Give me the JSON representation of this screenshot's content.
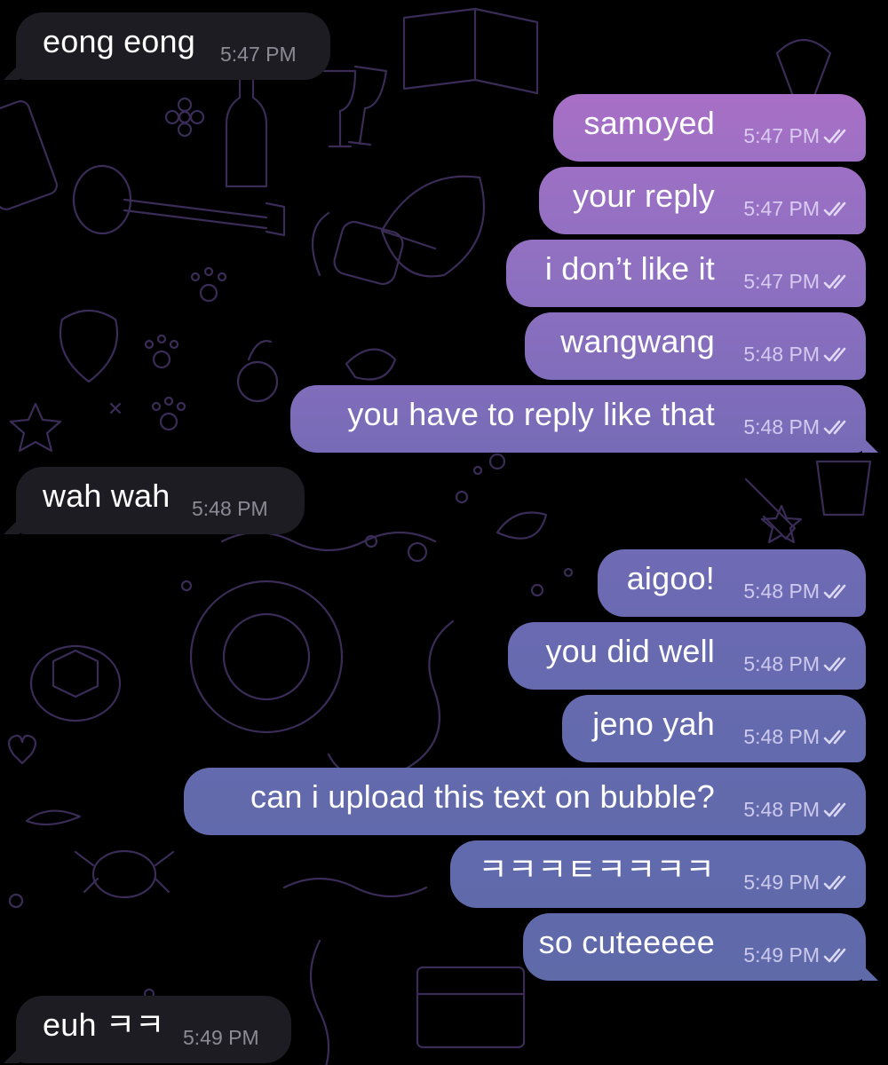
{
  "messages": [
    {
      "id": "m1",
      "dir": "in",
      "text": "eong eong",
      "time": "5:47 PM"
    },
    {
      "id": "m2",
      "dir": "out",
      "text": "samoyed",
      "time": "5:47 PM",
      "read": true
    },
    {
      "id": "m3",
      "dir": "out",
      "text": "your reply",
      "time": "5:47 PM",
      "read": true
    },
    {
      "id": "m4",
      "dir": "out",
      "text": "i don’t like it",
      "time": "5:47 PM",
      "read": true
    },
    {
      "id": "m5",
      "dir": "out",
      "text": "wangwang",
      "time": "5:48 PM",
      "read": true
    },
    {
      "id": "m6",
      "dir": "out",
      "text": "you have to reply like that",
      "time": "5:48 PM",
      "read": true
    },
    {
      "id": "m7",
      "dir": "in",
      "text": "wah wah",
      "time": "5:48 PM"
    },
    {
      "id": "m8",
      "dir": "out",
      "text": "aigoo!",
      "time": "5:48 PM",
      "read": true
    },
    {
      "id": "m9",
      "dir": "out",
      "text": "you did well",
      "time": "5:48 PM",
      "read": true
    },
    {
      "id": "m10",
      "dir": "out",
      "text": "jeno yah",
      "time": "5:48 PM",
      "read": true
    },
    {
      "id": "m11",
      "dir": "out",
      "text": "can i upload this text on bubble?",
      "time": "5:48 PM",
      "read": true
    },
    {
      "id": "m12",
      "dir": "out",
      "text": "ㅋㅋㅋㅌㅋㅋㅋㅋ",
      "time": "5:49 PM",
      "read": true
    },
    {
      "id": "m13",
      "dir": "out",
      "text": "so cuteeeee",
      "time": "5:49 PM",
      "read": true
    },
    {
      "id": "m14",
      "dir": "in",
      "text": "euh ㅋㅋ",
      "time": "5:49 PM"
    }
  ],
  "icons": {
    "read_receipt": "double-check-icon",
    "wallpaper": "doodle-wallpaper"
  },
  "colors": {
    "background": "#000000",
    "incoming_bubble": "#1d1c22",
    "outgoing_gradient_top": "#a56fc4",
    "outgoing_gradient_bottom": "#5f6aa9",
    "text": "#ffffff"
  }
}
